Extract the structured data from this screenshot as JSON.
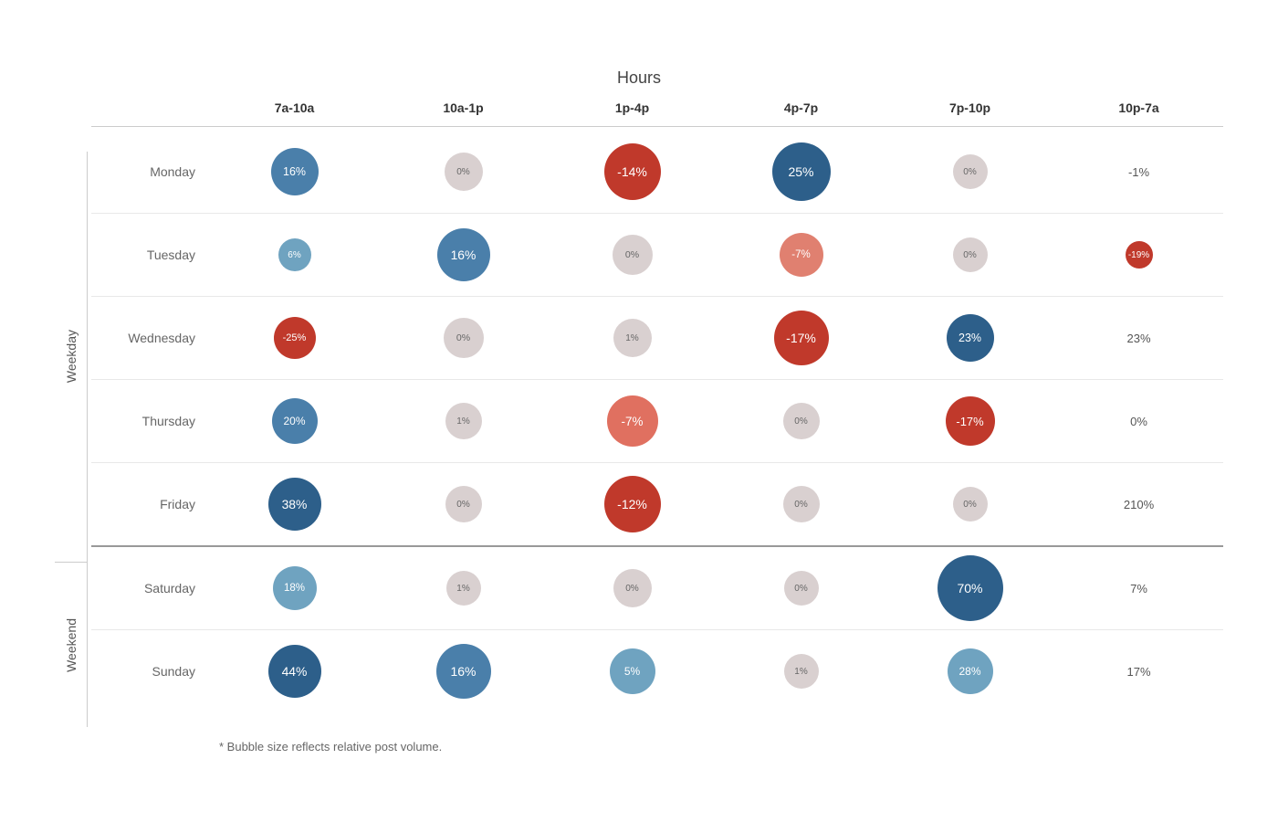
{
  "title": "Hours",
  "columns": [
    "7a-10a",
    "10a-1p",
    "1p-4p",
    "4p-7p",
    "7p-10p",
    "10p-7a"
  ],
  "sections": [
    {
      "label": "Weekday",
      "days": [
        {
          "name": "Monday",
          "cells": [
            {
              "value": "16%",
              "size": 52,
              "colorClass": "blue-mid"
            },
            {
              "value": "0%",
              "size": 42,
              "colorClass": "neutral"
            },
            {
              "value": "-14%",
              "size": 62,
              "colorClass": "red-dark"
            },
            {
              "value": "25%",
              "size": 64,
              "colorClass": "blue-dark"
            },
            {
              "value": "0%",
              "size": 38,
              "colorClass": "neutral"
            },
            {
              "value": "-1%",
              "size": 0,
              "colorClass": "none",
              "plain": true
            }
          ]
        },
        {
          "name": "Tuesday",
          "cells": [
            {
              "value": "6%",
              "size": 36,
              "colorClass": "blue-light"
            },
            {
              "value": "16%",
              "size": 58,
              "colorClass": "blue-mid"
            },
            {
              "value": "0%",
              "size": 44,
              "colorClass": "neutral"
            },
            {
              "value": "-7%",
              "size": 48,
              "colorClass": "red-light"
            },
            {
              "value": "0%",
              "size": 38,
              "colorClass": "neutral"
            },
            {
              "value": "-19%",
              "size": 30,
              "colorClass": "red-dark",
              "small": true
            }
          ]
        },
        {
          "name": "Wednesday",
          "cells": [
            {
              "value": "-25%",
              "size": 46,
              "colorClass": "red-dark"
            },
            {
              "value": "0%",
              "size": 44,
              "colorClass": "neutral"
            },
            {
              "value": "1%",
              "size": 42,
              "colorClass": "neutral"
            },
            {
              "value": "-17%",
              "size": 60,
              "colorClass": "red-dark"
            },
            {
              "value": "23%",
              "size": 52,
              "colorClass": "blue-dark"
            },
            {
              "value": "23%",
              "size": 0,
              "colorClass": "none",
              "plain": true
            }
          ]
        },
        {
          "name": "Thursday",
          "cells": [
            {
              "value": "20%",
              "size": 50,
              "colorClass": "blue-mid"
            },
            {
              "value": "1%",
              "size": 40,
              "colorClass": "neutral"
            },
            {
              "value": "-7%",
              "size": 56,
              "colorClass": "coral"
            },
            {
              "value": "0%",
              "size": 40,
              "colorClass": "neutral"
            },
            {
              "value": "-17%",
              "size": 54,
              "colorClass": "red-dark"
            },
            {
              "value": "0%",
              "size": 0,
              "colorClass": "none",
              "plain": true
            }
          ]
        },
        {
          "name": "Friday",
          "cells": [
            {
              "value": "38%",
              "size": 58,
              "colorClass": "blue-dark"
            },
            {
              "value": "0%",
              "size": 40,
              "colorClass": "neutral"
            },
            {
              "value": "-12%",
              "size": 62,
              "colorClass": "red-dark"
            },
            {
              "value": "0%",
              "size": 40,
              "colorClass": "neutral"
            },
            {
              "value": "0%",
              "size": 38,
              "colorClass": "neutral"
            },
            {
              "value": "210%",
              "size": 0,
              "colorClass": "none",
              "plain": true
            }
          ]
        }
      ]
    },
    {
      "label": "Weekend",
      "days": [
        {
          "name": "Saturday",
          "cells": [
            {
              "value": "18%",
              "size": 48,
              "colorClass": "blue-light"
            },
            {
              "value": "1%",
              "size": 38,
              "colorClass": "neutral"
            },
            {
              "value": "0%",
              "size": 42,
              "colorClass": "neutral"
            },
            {
              "value": "0%",
              "size": 38,
              "colorClass": "neutral"
            },
            {
              "value": "70%",
              "size": 72,
              "colorClass": "blue-dark"
            },
            {
              "value": "7%",
              "size": 0,
              "colorClass": "none",
              "plain": true
            }
          ]
        },
        {
          "name": "Sunday",
          "cells": [
            {
              "value": "44%",
              "size": 58,
              "colorClass": "blue-dark"
            },
            {
              "value": "16%",
              "size": 60,
              "colorClass": "blue-mid"
            },
            {
              "value": "5%",
              "size": 50,
              "colorClass": "blue-light"
            },
            {
              "value": "1%",
              "size": 38,
              "colorClass": "neutral"
            },
            {
              "value": "28%",
              "size": 50,
              "colorClass": "blue-light"
            },
            {
              "value": "17%",
              "size": 0,
              "colorClass": "none",
              "plain": true
            }
          ]
        }
      ]
    }
  ],
  "footnote": "* Bubble size reflects relative post volume."
}
